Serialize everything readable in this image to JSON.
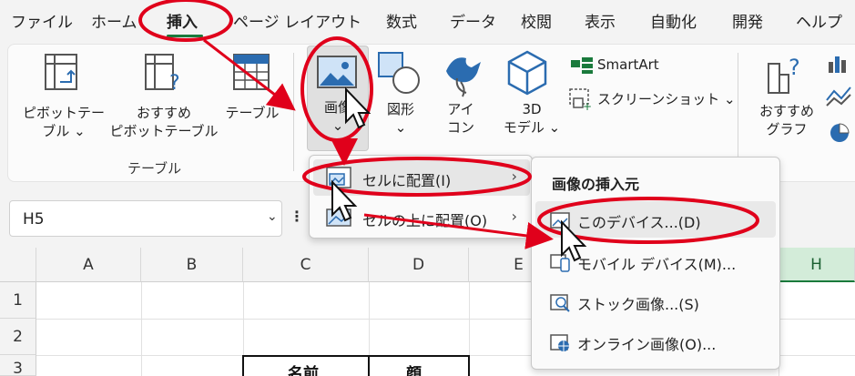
{
  "menu_tabs": [
    "ファイル",
    "ホーム",
    "挿入",
    "ページ レイアウト",
    "数式",
    "データ",
    "校閲",
    "表示",
    "自動化",
    "開発",
    "ヘルプ"
  ],
  "active_tab": "挿入",
  "ribbon": {
    "pivot_table": [
      "ピボットテー",
      "ブル ⌄"
    ],
    "recommended_pivot": [
      "おすすめ",
      "ピボットテーブル"
    ],
    "table": "テーブル",
    "group_table": "テーブル",
    "image": [
      "画像",
      "⌄"
    ],
    "shapes": [
      "図形",
      "⌄"
    ],
    "icons": [
      "アイ",
      "コン"
    ],
    "models3d": [
      "3D",
      "モデル ⌄"
    ],
    "smartart": "SmartArt",
    "screenshot": "スクリーンショット ⌄",
    "recommended_charts": [
      "おすすめ",
      "グラフ"
    ]
  },
  "name_box": {
    "value": "H5",
    "caret": "⌄"
  },
  "formula_dots": "⋮",
  "columns": [
    "A",
    "B",
    "C",
    "D",
    "E",
    "H"
  ],
  "rows": [
    "1",
    "2",
    "3"
  ],
  "cells": {
    "c3": "名前",
    "d3": "顔"
  },
  "menu_image": {
    "items": [
      {
        "label": "セルに配置(I)",
        "arrow": "›"
      },
      {
        "label": "セルの上に配置(O)",
        "arrow": "›"
      }
    ]
  },
  "menu_insert_from": {
    "title": "画像の挿入元",
    "items": [
      {
        "label": "このデバイス...(D)"
      },
      {
        "label": "モバイル デバイス(M)..."
      },
      {
        "label": "ストック画像...(S)"
      },
      {
        "label": "オンライン画像(O)..."
      }
    ]
  },
  "colors": {
    "accent_green": "#1a7a3c",
    "annotation_red": "#e0001b",
    "icon_blue": "#2b6cb0"
  }
}
